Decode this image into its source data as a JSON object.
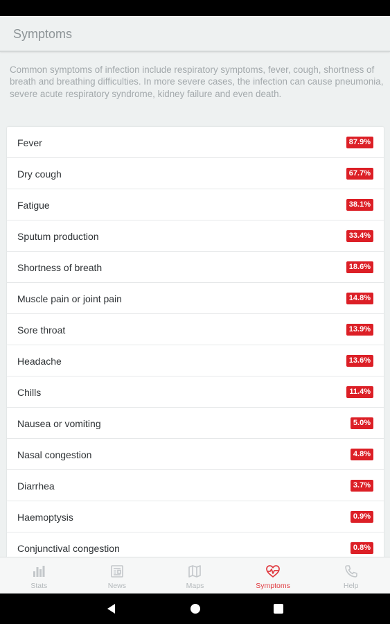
{
  "app_bar": {
    "title": "Symptoms"
  },
  "intro": "Common symptoms of infection include respiratory symptoms, fever, cough, shortness of breath and breathing difficulties. In more severe cases, the infection can cause pneumonia, severe acute respiratory syndrome, kidney failure and even death.",
  "symptoms": [
    {
      "name": "Fever",
      "percent": "87.9%"
    },
    {
      "name": "Dry cough",
      "percent": "67.7%"
    },
    {
      "name": "Fatigue",
      "percent": "38.1%"
    },
    {
      "name": "Sputum production",
      "percent": "33.4%"
    },
    {
      "name": "Shortness of breath",
      "percent": "18.6%"
    },
    {
      "name": "Muscle pain or joint pain",
      "percent": "14.8%"
    },
    {
      "name": "Sore throat",
      "percent": "13.9%"
    },
    {
      "name": "Headache",
      "percent": "13.6%"
    },
    {
      "name": "Chills",
      "percent": "11.4%"
    },
    {
      "name": "Nausea or vomiting",
      "percent": "5.0%"
    },
    {
      "name": "Nasal congestion",
      "percent": "4.8%"
    },
    {
      "name": "Diarrhea",
      "percent": "3.7%"
    },
    {
      "name": "Haemoptysis",
      "percent": "0.9%"
    },
    {
      "name": "Conjunctival congestion",
      "percent": "0.8%"
    }
  ],
  "bottom_nav": [
    {
      "label": "Stats",
      "icon": "bar-chart-icon",
      "active": false
    },
    {
      "label": "News",
      "icon": "newspaper-icon",
      "active": false
    },
    {
      "label": "Maps",
      "icon": "map-icon",
      "active": false
    },
    {
      "label": "Symptoms",
      "icon": "heart-pulse-icon",
      "active": true
    },
    {
      "label": "Help",
      "icon": "phone-icon",
      "active": false
    }
  ],
  "colors": {
    "accent": "#dc1f26",
    "active_nav": "#e0393f",
    "inactive_nav": "#b3b8bb"
  }
}
